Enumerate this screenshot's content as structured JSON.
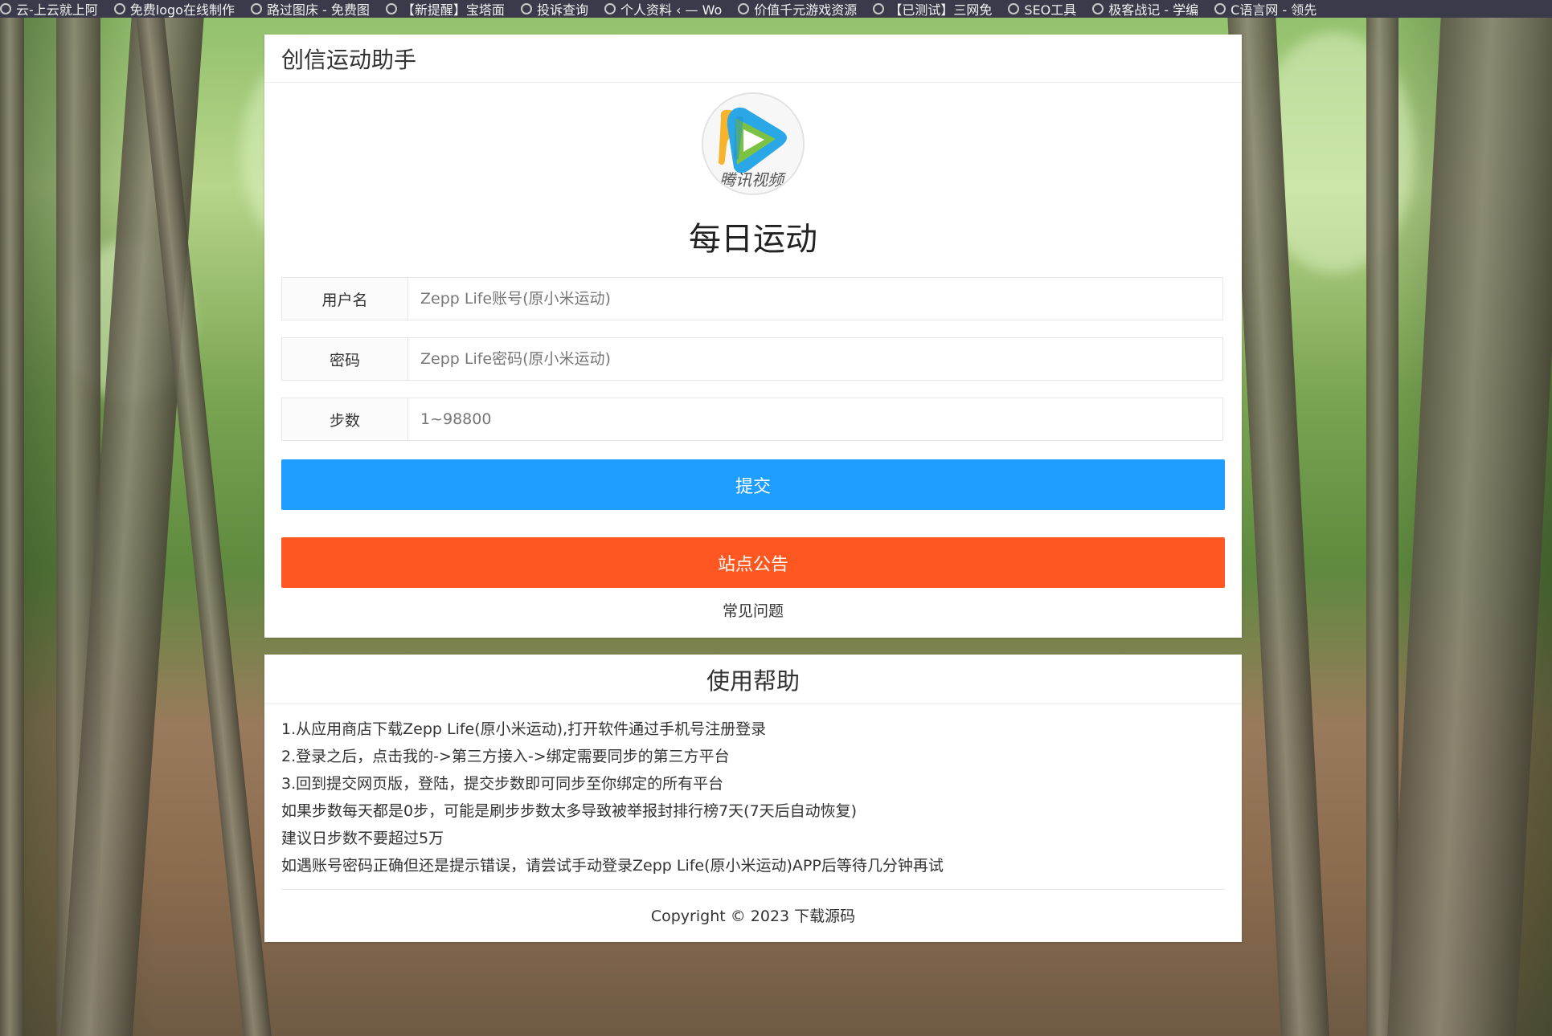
{
  "bookmarks": [
    "云-上云就上阿",
    "免费logo在线制作",
    "路过图床 - 免费图",
    "【新提醒】宝塔面",
    "投诉查询",
    "个人资料 ‹ — Wo",
    "价值千元游戏资源",
    "【已测试】三网免",
    "SEO工具",
    "极客战记 - 学编",
    "C语言网 - 领先"
  ],
  "header": {
    "title": "创信运动助手"
  },
  "logo": {
    "text": "腾讯视频",
    "icon": "tencent-video-logo"
  },
  "form": {
    "heading": "每日运动",
    "username_label": "用户名",
    "username_placeholder": "Zepp Life账号(原小米运动)",
    "password_label": "密码",
    "password_placeholder": "Zepp Life密码(原小米运动)",
    "steps_label": "步数",
    "steps_placeholder": "1~98800",
    "submit_label": "提交",
    "notice_label": "站点公告",
    "faq_label": "常见问题"
  },
  "help": {
    "title": "使用帮助",
    "lines": [
      "1.从应用商店下载Zepp Life(原小米运动),打开软件通过手机号注册登录",
      "2.登录之后，点击我的->第三方接入->绑定需要同步的第三方平台",
      "3.回到提交网页版，登陆，提交步数即可同步至你绑定的所有平台",
      "如果步数每天都是0步，可能是刷步步数太多导致被举报封排行榜7天(7天后自动恢复)",
      "建议日步数不要超过5万",
      "如遇账号密码正确但还是提示错误，请尝试手动登录Zepp Life(原小米运动)APP后等待几分钟再试"
    ],
    "copyright": "Copyright © 2023 下载源码"
  },
  "colors": {
    "submit": "#1e9fff",
    "notice": "#ff5722"
  }
}
